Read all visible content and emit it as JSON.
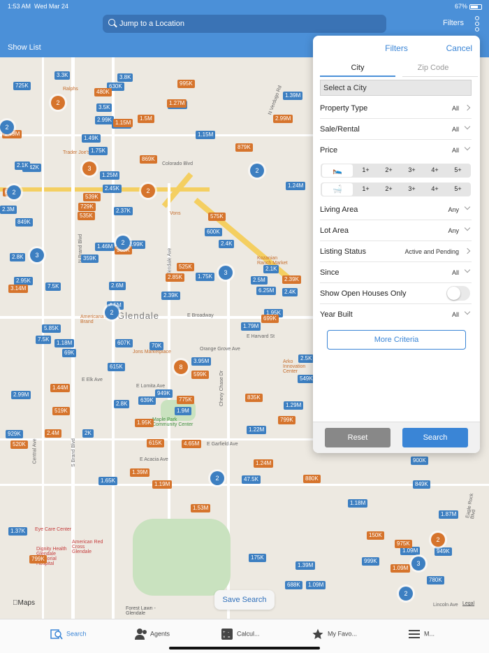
{
  "status": {
    "time": "1:53 AM",
    "date": "Wed Mar 24",
    "battery": "67%"
  },
  "nav": {
    "search_placeholder": "Jump to a Location",
    "filters": "Filters",
    "show_list": "Show List"
  },
  "map": {
    "city": "Glendale",
    "maps_logo": "Maps",
    "legal": "Legal",
    "save_search": "Save Search",
    "streets": [
      "N Brand Blvd",
      "E Broadway",
      "Glendale Ave",
      "Colorado Blvd",
      "E Elk Ave",
      "E Acacia Ave",
      "Chevy Chase Dr",
      "E Harvard St",
      "Orange Grove Ave",
      "E Lomita Ave",
      "E Garfield Ave",
      "S Brand Blvd",
      "N Verdugo Rd",
      "Lincoln Ave",
      "Eagle Rock Blvd",
      "Central Ave"
    ],
    "pois": [
      "Ralphs",
      "Trader Joe's",
      "Vons",
      "Jons Marketplace",
      "Maple Park Community Center",
      "Forest Lawn - Glendale",
      "Eye Care Center",
      "American Red Cross Glendale",
      "Dignity Health Glendale Memorial Hospital",
      "Kozanian Ranch Market",
      "Arko Innovation Center",
      "Americana at Brand"
    ],
    "blue_pins": [
      "725K",
      "3.3K",
      "3.8K",
      "630K",
      "3.5K",
      "2.99K",
      "1.49K",
      "1.75K",
      "1.25M",
      "2.45K",
      "2.37K",
      "2.42K",
      "2.1K",
      "2.3M",
      "849K",
      "2.8K",
      "2.95K",
      "7.5K",
      "359K",
      "2.99K",
      "1.46M",
      "4.5M",
      "2.6M",
      "5.85K",
      "7.5K",
      "1.18M",
      "69K",
      "607K",
      "70K",
      "615K",
      "3.95M",
      "949K",
      "639K",
      "2.8K",
      "1.9M",
      "1.65K",
      "2K",
      "2.99M",
      "929K",
      "1.27M",
      "1.15M",
      "600K",
      "2.4K",
      "1.75K",
      "2.39K",
      "2.1K",
      "2.5M",
      "6.25M",
      "1.79M",
      "2.4K",
      "1.95K",
      "1.39M",
      "1.15M",
      "1.24M",
      "2.5K",
      "549K",
      "1.29M",
      "1.22M",
      "47.5K",
      "900K",
      "849K",
      "1.18M",
      "1.87M",
      "999K",
      "1.09M",
      "949K",
      "780K",
      "1.39M",
      "688K",
      "1.09M",
      "175K",
      "1.37K"
    ],
    "orange_pins": [
      "995K",
      "480K",
      "1.27M",
      "1.5M",
      "1.15M",
      "1.49M",
      "869K",
      "635K",
      "539K",
      "729K",
      "535K",
      "385K",
      "3.14M",
      "525K",
      "2.85K",
      "575K",
      "879K",
      "2.99M",
      "699K",
      "2.39K",
      "599K",
      "1.44M",
      "519K",
      "775K",
      "1.95K",
      "4.65M",
      "615K",
      "835K",
      "799K",
      "2.4M",
      "520K",
      "1.39M",
      "1.19M",
      "1.24M",
      "880K",
      "1.53M",
      "150K",
      "975K",
      "1.09M",
      "799K"
    ],
    "clusters": [
      {
        "label": "2",
        "color": "orange"
      },
      {
        "label": "3",
        "color": "orange"
      },
      {
        "label": "2",
        "color": "orange"
      },
      {
        "label": "2",
        "color": "blue"
      },
      {
        "label": "2",
        "color": "blue"
      },
      {
        "label": "2",
        "color": "blue"
      },
      {
        "label": "3",
        "color": "blue"
      },
      {
        "label": "2",
        "color": "blue"
      },
      {
        "label": "2",
        "color": "blue"
      },
      {
        "label": "8",
        "color": "orange"
      },
      {
        "label": "3",
        "color": "blue"
      },
      {
        "label": "2",
        "color": "blue"
      },
      {
        "label": "2",
        "color": "orange"
      },
      {
        "label": "3",
        "color": "blue"
      },
      {
        "label": "2",
        "color": "blue"
      }
    ]
  },
  "filters": {
    "title": "Filters",
    "cancel": "Cancel",
    "tab_city": "City",
    "tab_zip": "Zip Code",
    "select_city": "Select a City",
    "rows": [
      {
        "label": "Property Type",
        "value": "All"
      },
      {
        "label": "Sale/Rental",
        "value": "All"
      },
      {
        "label": "Price",
        "value": "All"
      },
      {
        "label": "Living Area",
        "value": "Any"
      },
      {
        "label": "Lot Area",
        "value": "Any"
      },
      {
        "label": "Listing Status",
        "value": "Active and Pending"
      },
      {
        "label": "Since",
        "value": "All"
      },
      {
        "label": "Show Open Houses Only",
        "value": ""
      },
      {
        "label": "Year Built",
        "value": "All"
      }
    ],
    "bed_options": [
      "1+",
      "2+",
      "3+",
      "4+",
      "5+"
    ],
    "bath_options": [
      "1+",
      "2+",
      "3+",
      "4+",
      "5+"
    ],
    "more_criteria": "More Criteria",
    "reset": "Reset",
    "search": "Search"
  },
  "tabs": [
    {
      "label": "Search",
      "icon": "search-map-icon"
    },
    {
      "label": "Agents",
      "icon": "agents-icon"
    },
    {
      "label": "Calcul...",
      "icon": "calculator-icon"
    },
    {
      "label": "My Favo...",
      "icon": "star-icon"
    },
    {
      "label": "M...",
      "icon": "menu-icon"
    }
  ],
  "colors": {
    "nav_blue": "#4b90d8",
    "accent": "#3a85d6",
    "pin_blue": "#3d7fc1",
    "pin_orange": "#d6742c"
  }
}
